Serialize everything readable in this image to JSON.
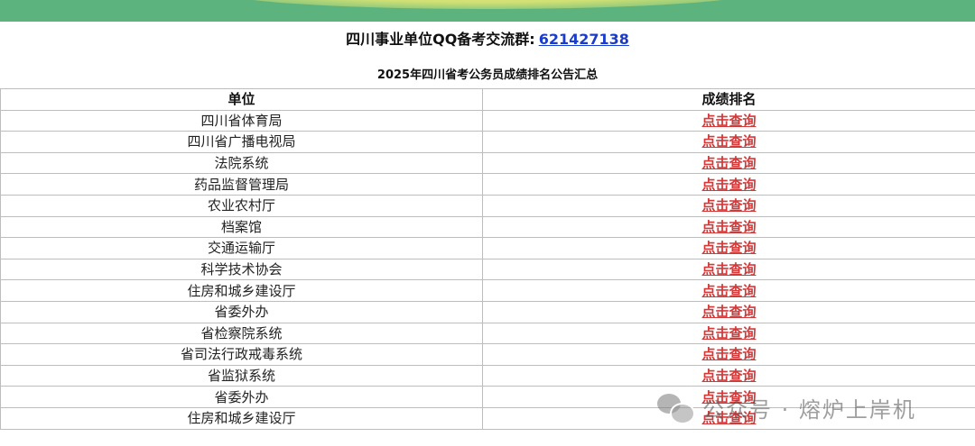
{
  "group": {
    "label": "四川事业单位QQ备考交流群:",
    "number": "621427138"
  },
  "subtitle": "2025年四川省考公务员成绩排名公告汇总",
  "table": {
    "headers": {
      "unit": "单位",
      "rank": "成绩排名"
    },
    "link_label": "点击查询",
    "rows": [
      {
        "unit": "四川省体育局",
        "link": "点击查询"
      },
      {
        "unit": "四川省广播电视局",
        "link": "点击查询"
      },
      {
        "unit": "法院系统",
        "link": "点击查询"
      },
      {
        "unit": "药品监督管理局",
        "link": "点击查询"
      },
      {
        "unit": "农业农村厅",
        "link": "点击查询"
      },
      {
        "unit": "档案馆",
        "link": "点击查询"
      },
      {
        "unit": "交通运输厅",
        "link": "点击查询"
      },
      {
        "unit": "科学技术协会",
        "link": "点击查询"
      },
      {
        "unit": "住房和城乡建设厅",
        "link": "点击查询"
      },
      {
        "unit": "省委外办",
        "link": "点击查询"
      },
      {
        "unit": "省检察院系统",
        "link": "点击查询"
      },
      {
        "unit": "省司法行政戒毒系统",
        "link": "点击查询"
      },
      {
        "unit": "省监狱系统",
        "link": "点击查询"
      },
      {
        "unit": "省委外办",
        "link": "点击查询"
      },
      {
        "unit": "住房和城乡建设厅",
        "link": "点击查询"
      }
    ]
  },
  "watermark": {
    "text": "公众号 · 熔炉上岸机",
    "icon": "wechat-icon"
  },
  "colors": {
    "banner": "#5db37e",
    "link": "#d23a3a",
    "group_number": "#1a3ccc"
  }
}
